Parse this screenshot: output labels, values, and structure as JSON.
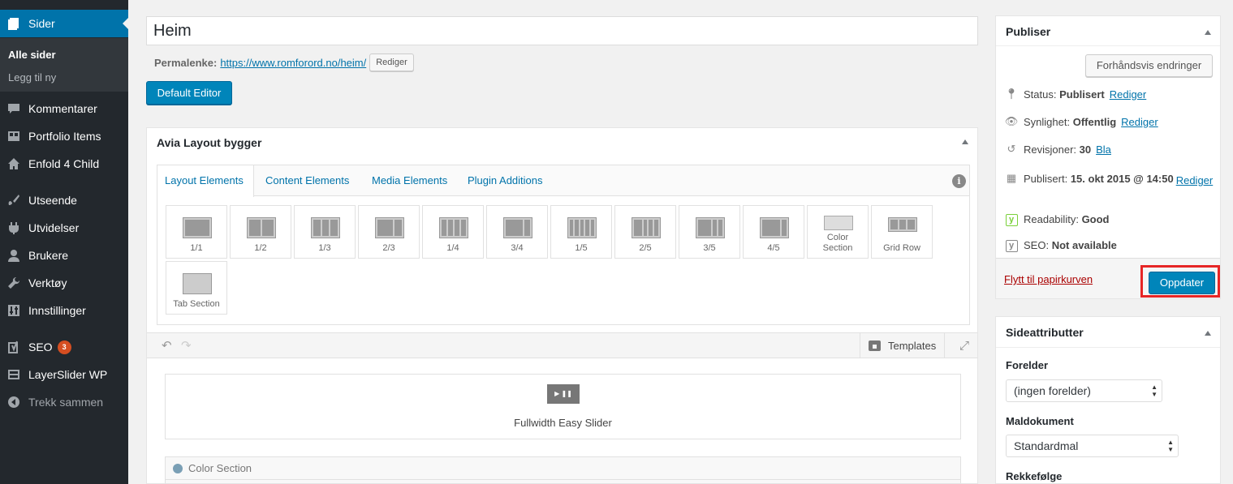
{
  "sidebar": {
    "pages": "Sider",
    "all_pages": "Alle sider",
    "add_new": "Legg til ny",
    "comments": "Kommentarer",
    "portfolio": "Portfolio Items",
    "enfold": "Enfold 4 Child",
    "appearance": "Utseende",
    "plugins": "Utvidelser",
    "users": "Brukere",
    "tools": "Verktøy",
    "settings": "Innstillinger",
    "seo": "SEO",
    "seo_badge": "3",
    "layerslider": "LayerSlider WP",
    "collapse": "Trekk sammen"
  },
  "editor": {
    "title": "Heim",
    "permalink_label": "Permalenke:",
    "permalink_url": "https://www.romforord.no/heim/",
    "permalink_edit": "Rediger",
    "default_editor": "Default Editor"
  },
  "avia": {
    "title": "Avia Layout bygger",
    "tabs": [
      "Layout Elements",
      "Content Elements",
      "Media Elements",
      "Plugin Additions"
    ],
    "info": "i",
    "elements": [
      "1/1",
      "1/2",
      "1/3",
      "2/3",
      "1/4",
      "3/4",
      "1/5",
      "2/5",
      "3/5",
      "4/5",
      "Color Section",
      "Grid Row",
      "Tab Section"
    ],
    "templates": "Templates",
    "slider_label": "Fullwidth Easy Slider",
    "slider_icon": "▶ ❚❚",
    "color_section": "Color Section"
  },
  "publish": {
    "title": "Publiser",
    "preview": "Forhåndsvis endringer",
    "status_label": "Status:",
    "status_value": "Publisert",
    "visibility_label": "Synlighet:",
    "visibility_value": "Offentlig",
    "revisions_label": "Revisjoner:",
    "revisions_value": "30",
    "revisions_link": "Bla",
    "published_label": "Publisert:",
    "published_value": "15. okt 2015 @ 14:50",
    "edit": "Rediger",
    "readability_label": "Readability:",
    "readability_value": "Good",
    "seo_label": "SEO:",
    "seo_value": "Not available",
    "trash": "Flytt til papirkurven",
    "update": "Oppdater"
  },
  "attributes": {
    "title": "Sideattributter",
    "parent_label": "Forelder",
    "parent_value": "(ingen forelder)",
    "template_label": "Maldokument",
    "template_value": "Standardmal",
    "order_label": "Rekkefølge"
  },
  "colors": {
    "admin_bar": "#23282d",
    "accent": "#0073aa",
    "primary_button": "#0085ba",
    "highlight": "#e62525"
  }
}
